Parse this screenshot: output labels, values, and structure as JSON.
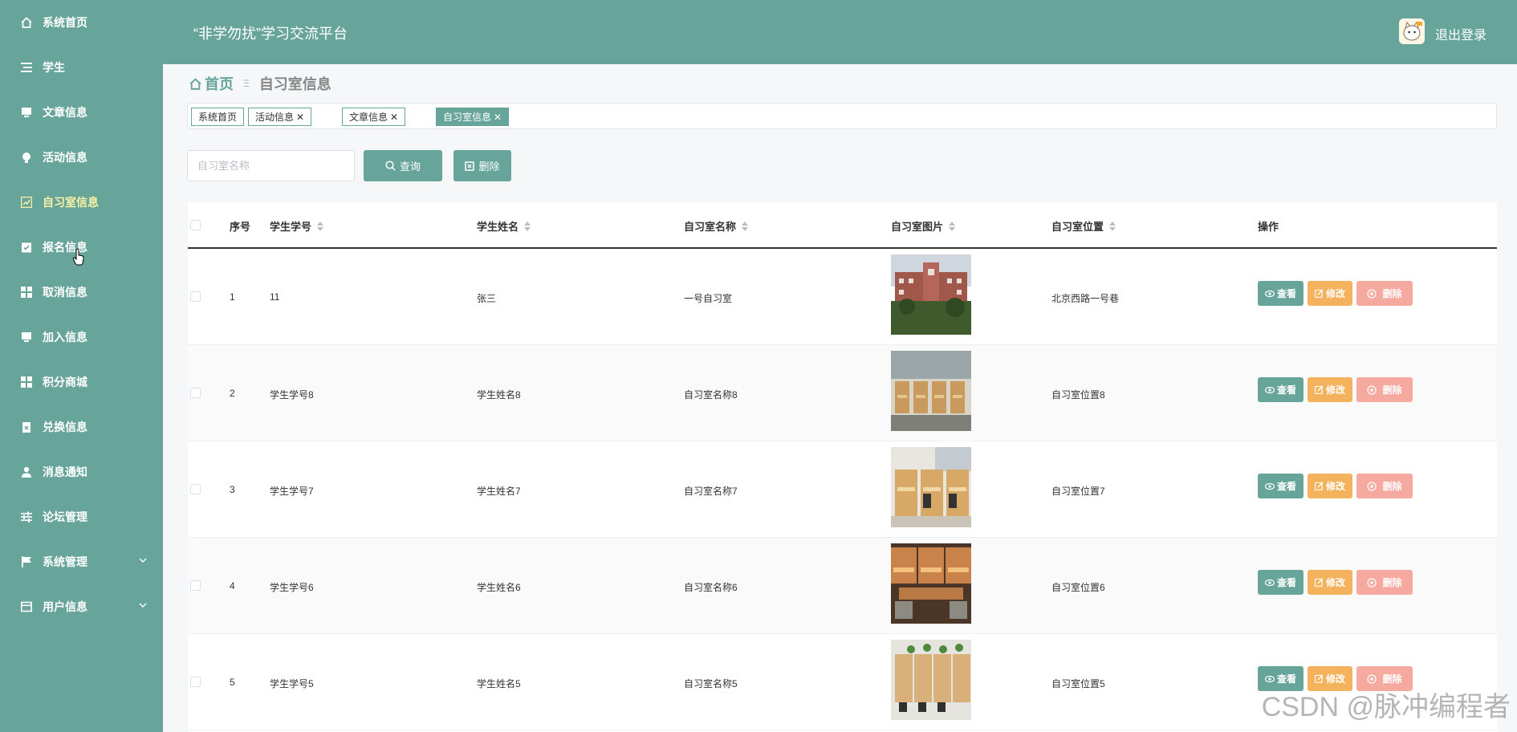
{
  "sidebar": {
    "items": [
      {
        "label": "系统首页",
        "icon": "home-icon"
      },
      {
        "label": "学生",
        "icon": "list-icon"
      },
      {
        "label": "文章信息",
        "icon": "monitor-icon"
      },
      {
        "label": "活动信息",
        "icon": "bulb-icon"
      },
      {
        "label": "自习室信息",
        "icon": "chart-icon",
        "active": true
      },
      {
        "label": "报名信息",
        "icon": "clipboard-icon"
      },
      {
        "label": "取消信息",
        "icon": "grid-icon"
      },
      {
        "label": "加入信息",
        "icon": "monitor-icon"
      },
      {
        "label": "积分商城",
        "icon": "grid-icon"
      },
      {
        "label": "兑换信息",
        "icon": "box-icon"
      },
      {
        "label": "消息通知",
        "icon": "user-icon"
      },
      {
        "label": "论坛管理",
        "icon": "sliders-icon"
      },
      {
        "label": "系统管理",
        "icon": "flag-icon",
        "expandable": true
      },
      {
        "label": "用户信息",
        "icon": "card-icon",
        "expandable": true
      }
    ]
  },
  "header": {
    "title": "“非学勿扰”学习交流平台",
    "logout": "退出登录"
  },
  "breadcrumb": {
    "home": "首页",
    "current": "自习室信息"
  },
  "tags": [
    {
      "label": "系统首页",
      "closable": false
    },
    {
      "label": "活动信息",
      "closable": true
    },
    {
      "label": "文章信息",
      "closable": true
    },
    {
      "label": "自习室信息",
      "closable": true,
      "active": true
    }
  ],
  "toolbar": {
    "search_placeholder": "自习室名称",
    "search_value": "",
    "query_label": "查询",
    "delete_label": "删除"
  },
  "table": {
    "columns": [
      "序号",
      "学生学号",
      "学生姓名",
      "自习室名称",
      "自习室图片",
      "自习室位置",
      "操作"
    ],
    "rows": [
      {
        "index": "1",
        "student_no": "11",
        "student_name": "张三",
        "room_name": "一号自习室",
        "location": "北京西路一号巷"
      },
      {
        "index": "2",
        "student_no": "学生学号8",
        "student_name": "学生姓名8",
        "room_name": "自习室名称8",
        "location": "自习室位置8"
      },
      {
        "index": "3",
        "student_no": "学生学号7",
        "student_name": "学生姓名7",
        "room_name": "自习室名称7",
        "location": "自习室位置7"
      },
      {
        "index": "4",
        "student_no": "学生学号6",
        "student_name": "学生姓名6",
        "room_name": "自习室名称6",
        "location": "自习室位置6"
      },
      {
        "index": "5",
        "student_no": "学生学号5",
        "student_name": "学生姓名5",
        "room_name": "自习室名称5",
        "location": "自习室位置5"
      }
    ],
    "actions": {
      "view": "查看",
      "edit": "修改",
      "delete": "删除"
    }
  },
  "watermark": "CSDN @脉冲编程者",
  "colors": {
    "primary": "#67a59b",
    "edit": "#f5b25c",
    "delete": "#f6a99f",
    "active_text": "#f8f1a6"
  }
}
